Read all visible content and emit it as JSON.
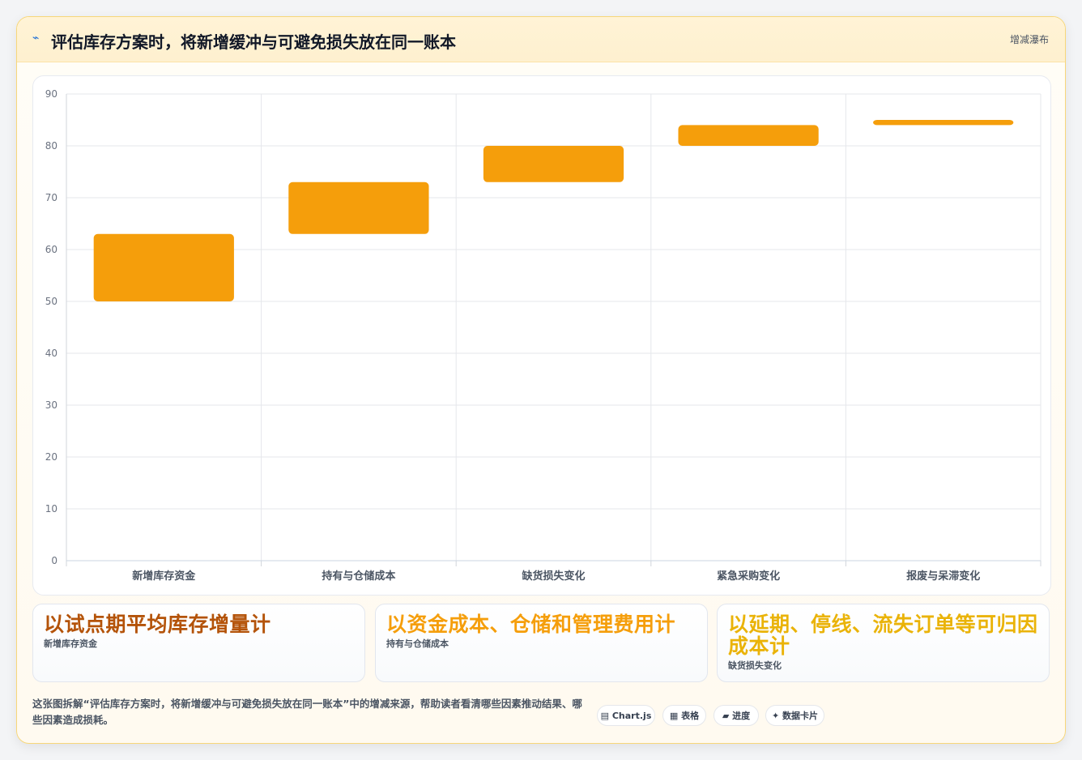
{
  "header": {
    "title": "评估库存方案时，将新增缓冲与可避免损失放在同一账本",
    "tag": "增减瀑布"
  },
  "chart_data": {
    "type": "bar",
    "subtype": "floating-waterfall",
    "categories": [
      "新增库存资金",
      "持有与仓储成本",
      "缺货损失变化",
      "紧急采购变化",
      "报废与呆滞变化"
    ],
    "ranges": [
      [
        50,
        63
      ],
      [
        63,
        73
      ],
      [
        73,
        80
      ],
      [
        80,
        84
      ],
      [
        84,
        85
      ]
    ],
    "ylim": [
      0,
      90
    ],
    "yticks": [
      0,
      10,
      20,
      30,
      40,
      50,
      60,
      70,
      80,
      90
    ],
    "grid": true,
    "bar_color": "#f59e0b"
  },
  "stats": [
    {
      "value": "以试点期平均库存增量计",
      "label": "新增库存资金",
      "color": "#b45309"
    },
    {
      "value": "以资金成本、仓储和管理费用计",
      "label": "持有与仓储成本",
      "color": "#f59e0b"
    },
    {
      "value": "以延期、停线、流失订单等可归因成本计",
      "label": "缺货损失变化",
      "color": "#eab308"
    }
  ],
  "footer": {
    "description": "这张图拆解“评估库存方案时，将新增缓冲与可避免损失放在同一账本”中的增减来源，帮助读者看清哪些因素推动结果、哪些因素造成损耗。",
    "chips": [
      {
        "icon": "▤",
        "label": "Chart.js"
      },
      {
        "icon": "▦",
        "label": "表格"
      },
      {
        "icon": "▰",
        "label": "进度"
      },
      {
        "icon": "✦",
        "label": "数据卡片"
      }
    ]
  }
}
